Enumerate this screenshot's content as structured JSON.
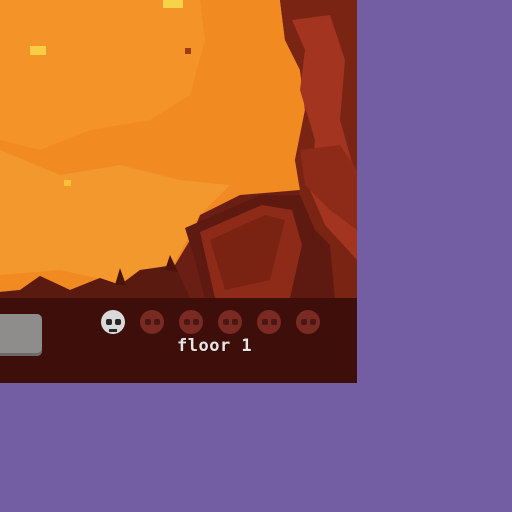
{
  "hud": {
    "floor_label": "floor 1",
    "lives": [
      {
        "icon": "skull-icon",
        "state": "filled"
      },
      {
        "icon": "skull-icon",
        "state": "empty"
      },
      {
        "icon": "skull-icon",
        "state": "empty"
      },
      {
        "icon": "skull-icon",
        "state": "empty"
      },
      {
        "icon": "skull-icon",
        "state": "empty"
      },
      {
        "icon": "skull-icon",
        "state": "empty"
      }
    ]
  },
  "colors": {
    "backdrop": "#735ea3",
    "lava": "#f28a22",
    "rock": "#8e2a18",
    "skull_filled": "#d9d9d9",
    "skull_empty": "#7a2a22"
  }
}
